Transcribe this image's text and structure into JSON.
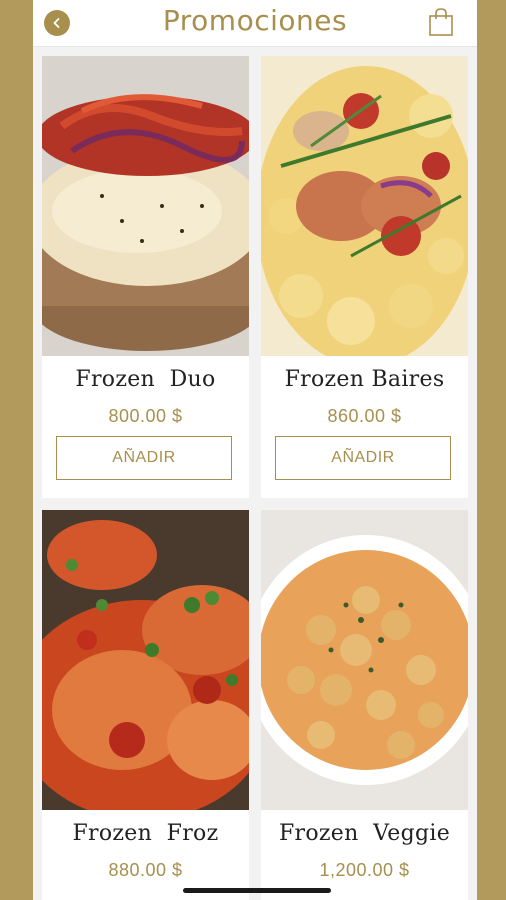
{
  "header": {
    "title": "Promociones",
    "back_icon": "chevron-left-icon",
    "cart_icon": "shopping-bag-icon"
  },
  "colors": {
    "accent": "#a88f4e",
    "frame": "#b29a5c",
    "background": "#f2f2f2",
    "card": "#ffffff"
  },
  "products": [
    {
      "name": "Frozen  Duo",
      "price": "800.00 $",
      "add_label": "AÑADIR",
      "image": "cheese-pizza-photo"
    },
    {
      "name": "Frozen Baires",
      "price": "860.00 $",
      "add_label": "AÑADIR",
      "image": "fusilli-chicken-pasta-photo"
    },
    {
      "name": "Frozen  Froz",
      "price": "880.00 $",
      "image": "chicken-tomato-sauce-photo"
    },
    {
      "name": "Frozen  Veggie",
      "price": "1,200.00 $",
      "image": "chickpea-stew-photo"
    }
  ]
}
